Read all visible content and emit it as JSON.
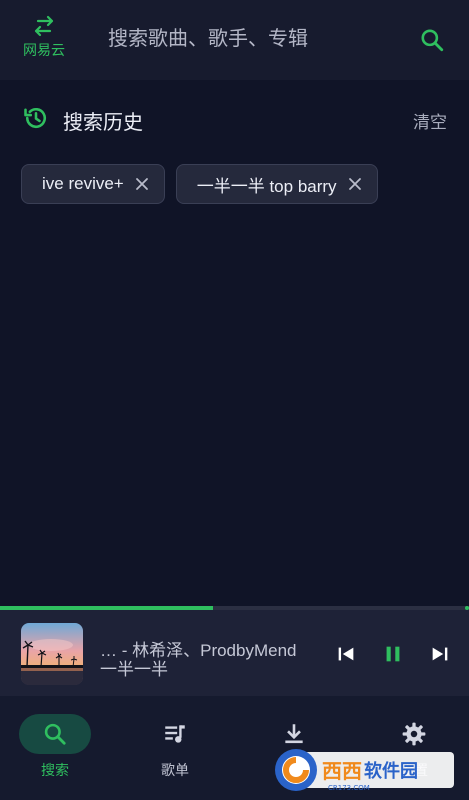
{
  "topbar": {
    "source_label": "网易云",
    "search_placeholder": "搜索歌曲、歌手、专辑"
  },
  "history": {
    "title": "搜索历史",
    "clear_label": "清空",
    "items": [
      {
        "label": "ive revive+"
      },
      {
        "label": "一半一半 top barry"
      }
    ]
  },
  "player": {
    "title": "…    - 林希泽、ProdbyMend",
    "album": "一半一半",
    "progress": 0.455
  },
  "nav": {
    "items": [
      {
        "label": "搜索",
        "active": true
      },
      {
        "label": "歌单",
        "active": false
      },
      {
        "label": "下载",
        "active": false
      },
      {
        "label": "设置",
        "active": false
      }
    ]
  },
  "watermark": {
    "text": "西西软件园",
    "subtext": "CR173.COM"
  },
  "colors": {
    "accent": "#2fbf5f",
    "background": "#101427",
    "topbar": "#171b2e",
    "player": "#1e2237",
    "nav_active_pill": "#174a42"
  },
  "icons": {
    "source_switch": "swap-arrows-icon",
    "search": "search-icon",
    "history": "history-icon",
    "close": "close-icon",
    "previous": "skip-previous-icon",
    "pause": "pause-icon",
    "next": "skip-next-icon",
    "playlist": "playlist-icon",
    "download": "download-icon",
    "settings": "gear-icon"
  }
}
